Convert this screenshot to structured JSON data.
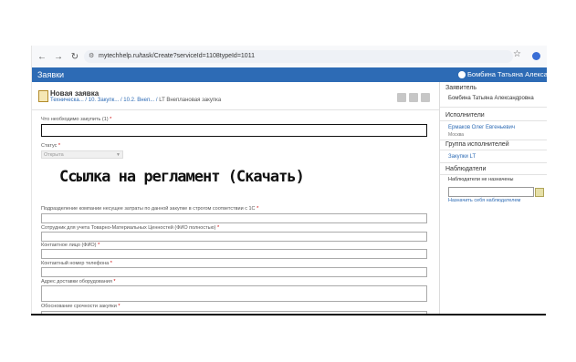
{
  "browser": {
    "url": "mytechhelp.ru/task/Create?serviceId=1108typeId=1011",
    "lock_icon": "site-info-icon"
  },
  "app": {
    "brand": "Заявки",
    "user": "Бомбина Татьяна Александровна"
  },
  "page": {
    "title": "Новая заявка",
    "breadcrumb": "Техническа... / 10. Закупк... / 10.2. Внеп... /",
    "breadcrumb_last": "LT Внеплановая закупка"
  },
  "form": {
    "field1_label": "Что необходимо закупить (1)",
    "status_label": "Статус",
    "status_value": "Открыта",
    "regulation_link": "Ссылка на регламент (Скачать)",
    "field2_label": "Подразделение компании несущее затраты по данной закупке в строгом соответствии с 1С",
    "field3_label": "Сотрудник для учета Товарно-Материальных Ценностей (ФИО полностью)",
    "field4_label": "Контактное лицо (ФИО)",
    "field5_label": "Контактный номер телефона",
    "field6_label": "Адрес доставки оборудования",
    "field7_label": "Обоснование срочности закупки",
    "req": "*"
  },
  "sidebar": {
    "requester_header": "Заявитель",
    "requester_name": "Бомбина Татьяна Александровна",
    "executors_header": "Исполнители",
    "executor_name": "Ермаков Олег Евгеньевич",
    "executor_city": "Москва",
    "group_header": "Группа исполнителей",
    "group_name": "Закупки LT",
    "observers_header": "Наблюдатели",
    "observers_none": "Наблюдатели не назначены",
    "assign_self": "Назначить себя наблюдателем"
  }
}
